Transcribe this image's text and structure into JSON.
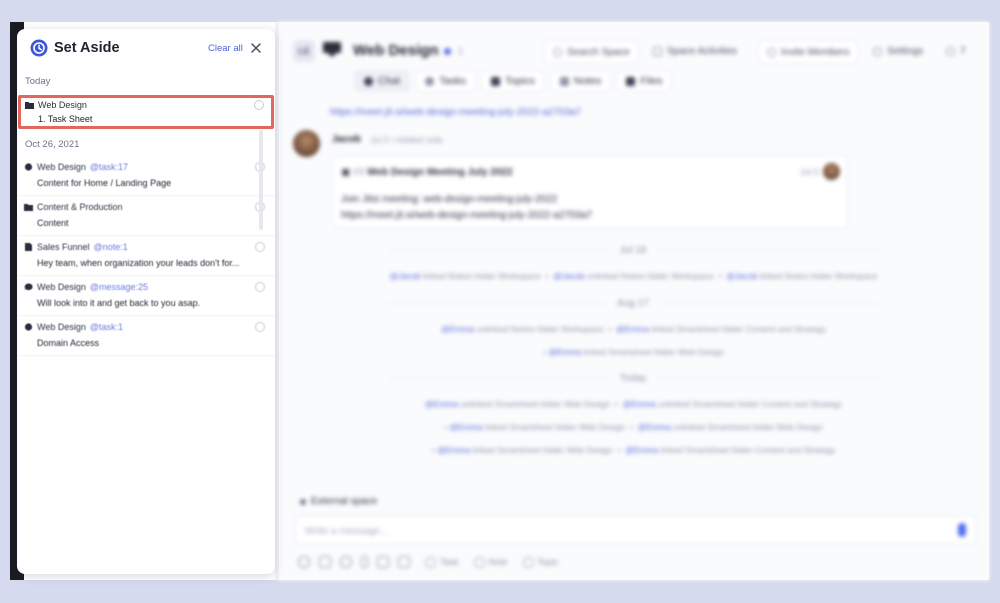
{
  "space": {
    "avatar_initials": "LE",
    "title": "Web Design",
    "title_extra": "1",
    "search_label": "Search Space",
    "activities_label": "Space Activities",
    "invite_label": "Invite Members",
    "settings_label": "Settings",
    "members_count": "7"
  },
  "tabs": [
    {
      "label": "Chat",
      "active": true
    },
    {
      "label": "Tasks",
      "active": false
    },
    {
      "label": "Topics",
      "active": false
    },
    {
      "label": "Notes",
      "active": false
    },
    {
      "label": "Files",
      "active": false
    }
  ],
  "feed": {
    "top_link": "https://meet.jit.si/web-design-meeting-july-2022-a2703a7",
    "message": {
      "author": "Jacob",
      "date": "Jul 5",
      "action": "Added note",
      "card": {
        "number": "#3",
        "title": "Web Design Meeting July 2022",
        "date": "Jul 5",
        "line1": "Join Jitsi meeting: web-design-meeting-july-2022",
        "line2": "https://meet.jit.si/web-design-meeting-july-2022-a2703a7"
      }
    },
    "separators": [
      "Jul 18",
      "Aug 17",
      "Today"
    ],
    "activities": {
      "jul18": [
        {
          "mention": "@Jacob",
          "text": " linked Notion folder Workspace"
        },
        {
          "mention": "@Jacob",
          "text": " unlinked Notion folder Workspace"
        },
        {
          "mention": "@Jacob",
          "text": " linked Notion folder Workspace"
        }
      ],
      "aug17_row1": [
        {
          "mention": "@Emma",
          "text": " unlinked Notion folder Workspace"
        },
        {
          "mention": "@Emma",
          "text": " linked Smartsheet folder Content and Strategy"
        }
      ],
      "aug17_row2": [
        {
          "mention": "@Emma",
          "text": " linked Smartsheet folder Web Design"
        }
      ],
      "today_row1": [
        {
          "mention": "@Emma",
          "text": " unlinked Smartsheet folder Web Design"
        },
        {
          "mention": "@Emma",
          "text": " unlinked Smartsheet folder Content and Strategy"
        }
      ],
      "today_row2": [
        {
          "mention": "@Emma",
          "text": " linked Smartsheet folder Web Design"
        },
        {
          "mention": "@Emma",
          "text": " unlinked Smartsheet folder Web Design"
        }
      ],
      "today_row3": [
        {
          "mention": "@Emma",
          "text": " linked Smartsheet folder Web Design"
        },
        {
          "mention": "@Emma",
          "text": " linked Smartsheet folder Content and Strategy"
        }
      ]
    },
    "external_space": "External space",
    "composer_placeholder": "Write a message...",
    "toolbar_chips": [
      "Task",
      "Note",
      "Topic"
    ]
  },
  "panel": {
    "title": "Set Aside",
    "clear_all": "Clear all",
    "sections": [
      {
        "label": "Today",
        "items": [
          {
            "icon": "folder-icon",
            "source": "Web Design",
            "ref": "",
            "text": "1. Task Sheet",
            "highlighted": true
          }
        ]
      },
      {
        "label": "Oct 26, 2021",
        "items": [
          {
            "icon": "task-icon",
            "source": "Web Design",
            "ref": "@task:17",
            "text": "Content for Home / Landing Page",
            "highlighted": false
          },
          {
            "icon": "folder-icon",
            "source": "Content & Production",
            "ref": "",
            "text": "Content",
            "highlighted": false
          },
          {
            "icon": "note-icon",
            "source": "Sales Funnel",
            "ref": "@note:1",
            "text": "Hey team, when organization your leads don't for...",
            "highlighted": false
          },
          {
            "icon": "chat-icon",
            "source": "Web Design",
            "ref": "@message:25",
            "text": "Will look into it and get back to you asap.",
            "highlighted": false
          },
          {
            "icon": "task-icon",
            "source": "Web Design",
            "ref": "@task:1",
            "text": "Domain Access",
            "highlighted": false
          }
        ]
      }
    ]
  },
  "colors": {
    "backdrop": "#d5daef",
    "accent": "#4e63d8",
    "highlight_border": "#e0675c",
    "mic": "#4e6cf2"
  }
}
